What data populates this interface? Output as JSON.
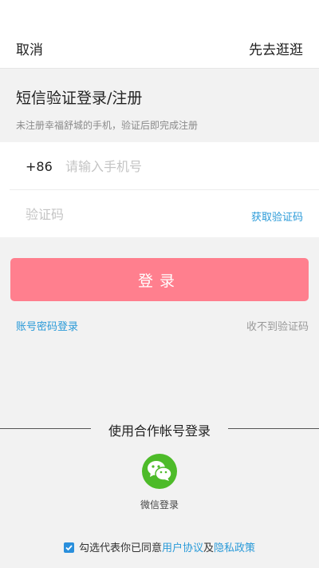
{
  "topbar": {
    "cancel_label": "取消",
    "browse_label": "先去逛逛"
  },
  "heading": {
    "title": "短信验证登录/注册",
    "subtitle": "未注册幸福舒城的手机，验证后即完成注册"
  },
  "form": {
    "country_code": "+86",
    "phone_value": "",
    "phone_placeholder": "请输入手机号",
    "code_value": "",
    "code_placeholder": "验证码",
    "get_code_label": "获取验证码"
  },
  "login_button_label": "登录",
  "links": {
    "password_login": "账号密码登录",
    "no_code": "收不到验证码"
  },
  "partner": {
    "title": "使用合作帐号登录",
    "wechat_label": "微信登录"
  },
  "agreement": {
    "checked": true,
    "prefix": "勾选代表你已同意",
    "user_agreement": "用户协议",
    "and": "及",
    "privacy_policy": "隐私政策"
  },
  "colors": {
    "accent": "#ff7f8e",
    "link": "#2a9ad8",
    "wechat": "#4dbb29",
    "checkbox": "#2a8fdc"
  },
  "icons": {
    "wechat": "wechat-icon",
    "checkbox": "checkmark-icon"
  }
}
